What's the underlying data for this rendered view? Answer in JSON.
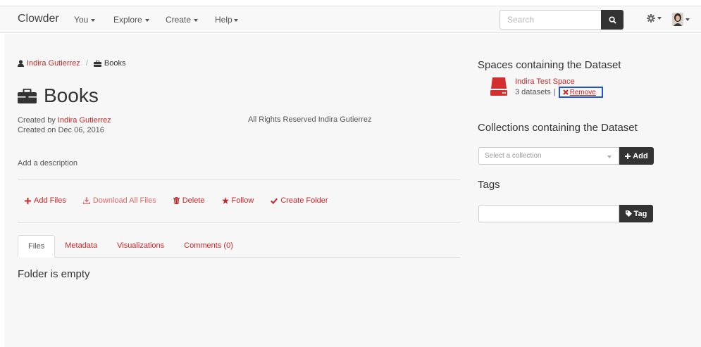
{
  "navbar": {
    "brand": "Clowder",
    "menus": [
      {
        "label": "You"
      },
      {
        "label": "Explore"
      },
      {
        "label": "Create"
      },
      {
        "label": "Help"
      }
    ],
    "search_placeholder": "Search"
  },
  "breadcrumb": {
    "user": "Indira Gutierrez",
    "separator": "/",
    "dataset": "Books"
  },
  "dataset": {
    "title": "Books",
    "created_by_label": "Created by",
    "created_by": "Indira Gutierrez",
    "created_on": "Created on Dec 06, 2016",
    "rights": "All Rights Reserved Indira Gutierrez",
    "description_prompt": "Add a description"
  },
  "actions": {
    "add_files": "Add Files",
    "download_all": "Download All Files",
    "delete": "Delete",
    "follow": "Follow",
    "create_folder": "Create Folder"
  },
  "tabs": [
    {
      "label": "Files",
      "active": true
    },
    {
      "label": "Metadata"
    },
    {
      "label": "Visualizations"
    },
    {
      "label": "Comments (0)"
    }
  ],
  "files": {
    "empty_message": "Folder is empty"
  },
  "sidebar": {
    "spaces_heading": "Spaces containing the Dataset",
    "space": {
      "name": "Indira Test Space",
      "count": "3 datasets",
      "separator": "|",
      "remove_label": "Remove"
    },
    "collections_heading": "Collections containing the Dataset",
    "collection_placeholder": "Select a collection",
    "add_label": "Add",
    "tags_heading": "Tags",
    "tag_label": "Tag"
  },
  "colors": {
    "accent": "#c62828",
    "dark_button": "#333333",
    "highlight_box": "#1e52e6"
  },
  "icons": [
    "search-icon",
    "gear-icon",
    "user-icon",
    "briefcase-icon",
    "plus-icon",
    "download-icon",
    "trash-icon",
    "star-icon",
    "check-icon",
    "hard-drive-icon",
    "close-icon",
    "tag-icon"
  ]
}
